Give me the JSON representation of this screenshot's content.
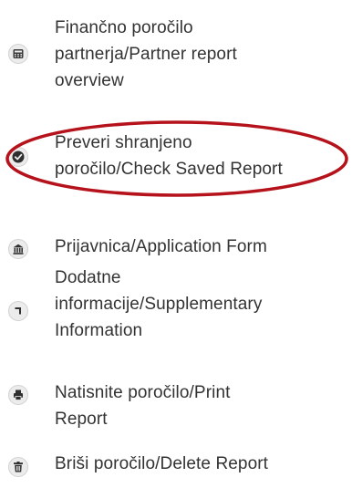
{
  "menu": {
    "items": [
      {
        "icon": "calculator-icon",
        "label": "Finančno poročilo\npartnerja/Partner report\noverview"
      },
      {
        "icon": "check-circle-icon",
        "label": "Preveri shranjeno\nporočilo/Check Saved Report"
      },
      {
        "icon": "bank-icon",
        "label": "Prijavnica/Application Form"
      },
      {
        "icon": "level-down-icon",
        "label": "Dodatne\ninformacije/Supplementary\nInformation"
      },
      {
        "icon": "print-icon",
        "label": "Natisnite poročilo/Print\nReport"
      },
      {
        "icon": "trash-icon",
        "label": "Briši poročilo/Delete Report"
      }
    ]
  },
  "annotation": {
    "ellipse_color": "#b5121b"
  }
}
